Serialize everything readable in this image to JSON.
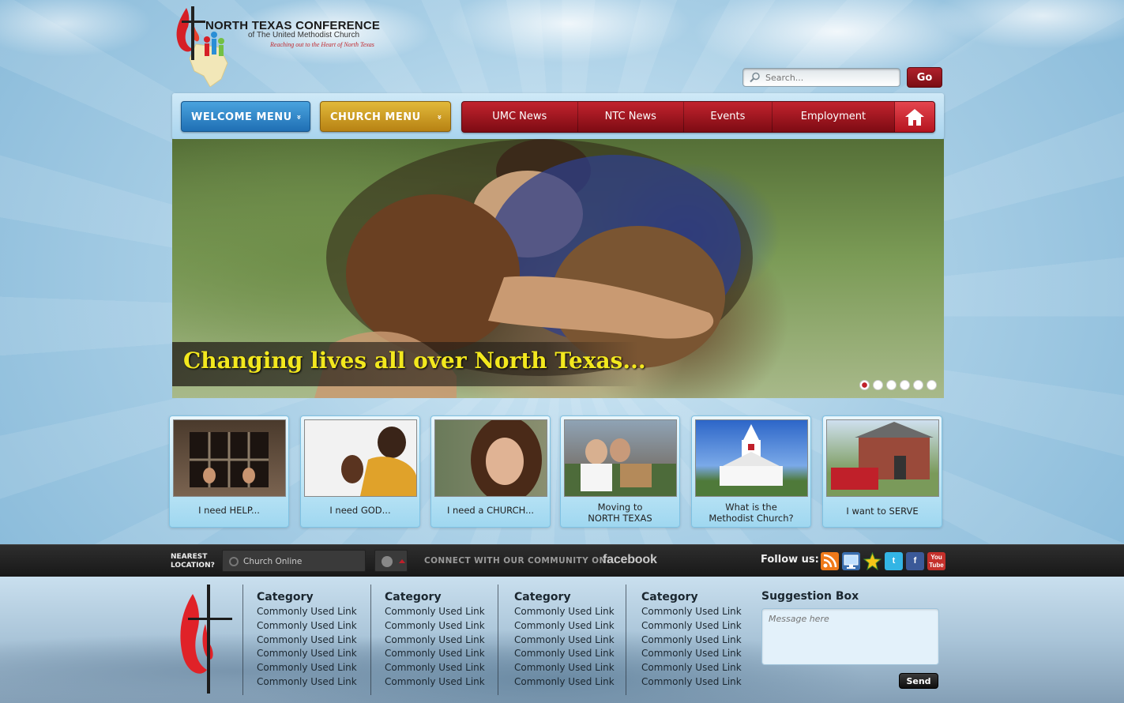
{
  "logo": {
    "title": "NORTH TEXAS CONFERENCE",
    "subtitle": "of The United Methodist Church",
    "tagline": "Reaching out to the Heart of North Texas"
  },
  "search": {
    "placeholder": "Search...",
    "go_label": "Go"
  },
  "nav": {
    "welcome_menu": "WELCOME MENU",
    "church_menu": "CHURCH MENU",
    "menu_arrow": "»",
    "items": [
      "UMC News",
      "NTC News",
      "Events",
      "Employment"
    ]
  },
  "hero": {
    "caption": "Changing lives all over North Texas...",
    "slide_count": 6,
    "active_slide": 1
  },
  "tiles": [
    {
      "label": "I need HELP..."
    },
    {
      "label": "I need GOD..."
    },
    {
      "label": "I need a CHURCH..."
    },
    {
      "label_line1": "Moving to",
      "label_line2": "NORTH TEXAS"
    },
    {
      "label_line1": "What is the",
      "label_line2": "Methodist Church?"
    },
    {
      "label": "I  want to SERVE"
    }
  ],
  "social_bar": {
    "nearest_line1": "NEAREST",
    "nearest_line2": "LOCATION?",
    "location_value": "Church Online",
    "connect_text": "CONNECT WITH OUR COMMUNITY ON",
    "facebook_word": "facebook",
    "follow_label": "Follow us:",
    "icons": [
      "rss-icon",
      "monitor-icon",
      "star-icon",
      "twitter-icon",
      "facebook-icon",
      "youtube-icon"
    ]
  },
  "footer": {
    "columns": [
      {
        "heading": "Category",
        "links": [
          "Commonly Used Link",
          "Commonly Used Link",
          "Commonly Used Link",
          "Commonly Used Link",
          "Commonly Used Link",
          "Commonly Used Link"
        ]
      },
      {
        "heading": "Category",
        "links": [
          "Commonly Used Link",
          "Commonly Used Link",
          "Commonly Used Link",
          "Commonly Used Link",
          "Commonly Used Link",
          "Commonly Used Link"
        ]
      },
      {
        "heading": "Category",
        "links": [
          "Commonly Used Link",
          "Commonly Used Link",
          "Commonly Used Link",
          "Commonly Used Link",
          "Commonly Used Link",
          "Commonly Used Link"
        ]
      },
      {
        "heading": "Category",
        "links": [
          "Commonly Used Link",
          "Commonly Used Link",
          "Commonly Used Link",
          "Commonly Used Link",
          "Commonly Used Link",
          "Commonly Used Link"
        ]
      }
    ],
    "suggestion_title": "Suggestion Box",
    "suggestion_placeholder": "Message here",
    "send_label": "Send"
  },
  "colors": {
    "brand_red": "#b0212b",
    "welcome_blue": "#1f6fb4",
    "church_gold": "#b78213",
    "caption_yellow": "#f3e81e"
  }
}
